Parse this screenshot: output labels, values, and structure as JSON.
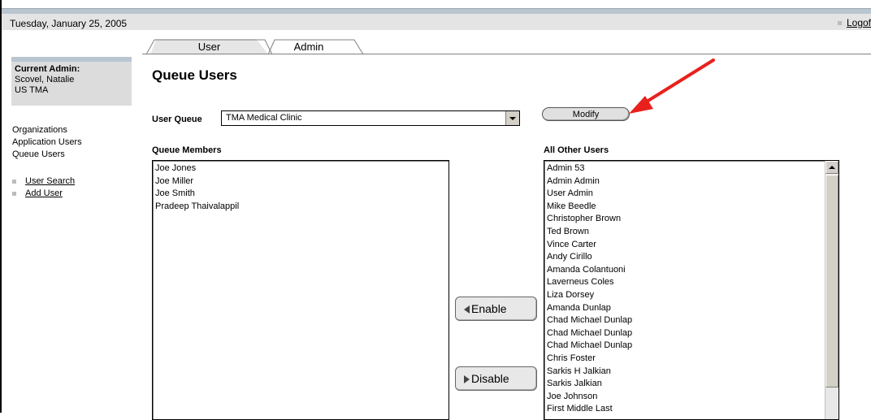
{
  "header": {
    "date": "Tuesday, January 25, 2005",
    "logoff_label": "Logof"
  },
  "tabs": [
    {
      "label": "User"
    },
    {
      "label": "Admin"
    }
  ],
  "sidebar": {
    "admin_label": "Current Admin:",
    "admin_name": "Scovel, Natalie",
    "admin_org": "US TMA",
    "nav": [
      "Organizations",
      "Application Users",
      "Queue Users"
    ],
    "links": [
      "User Search",
      "Add User"
    ]
  },
  "main": {
    "title": "Queue Users",
    "user_queue_label": "User Queue",
    "user_queue_value": "TMA Medical Clinic",
    "modify_label": "Modify",
    "members_label": "Queue Members",
    "members": [
      "Joe Jones",
      "Joe Miller",
      "Joe Smith",
      "Pradeep Thaivalappil"
    ],
    "others_label": "All Other Users",
    "others": [
      "Admin 53",
      "Admin Admin",
      "User Admin",
      "Mike Beedle",
      "Christopher Brown",
      "Ted Brown",
      "Vince Carter",
      "Andy Cirillo",
      "Amanda Colantuoni",
      "Laverneus Coles",
      "Liza Dorsey",
      "Amanda Dunlap",
      "Chad Michael Dunlap",
      "Chad Michael Dunlap",
      "Chad Michael Dunlap",
      "Chris Foster",
      "Sarkis H Jalkian",
      "Sarkis Jalkian",
      "Joe Johnson",
      "First Middle Last"
    ],
    "enable_label": "Enable",
    "disable_label": "Disable"
  },
  "colors": {
    "header_band": "#b9c6d0",
    "annotation_arrow": "#e8211d"
  }
}
